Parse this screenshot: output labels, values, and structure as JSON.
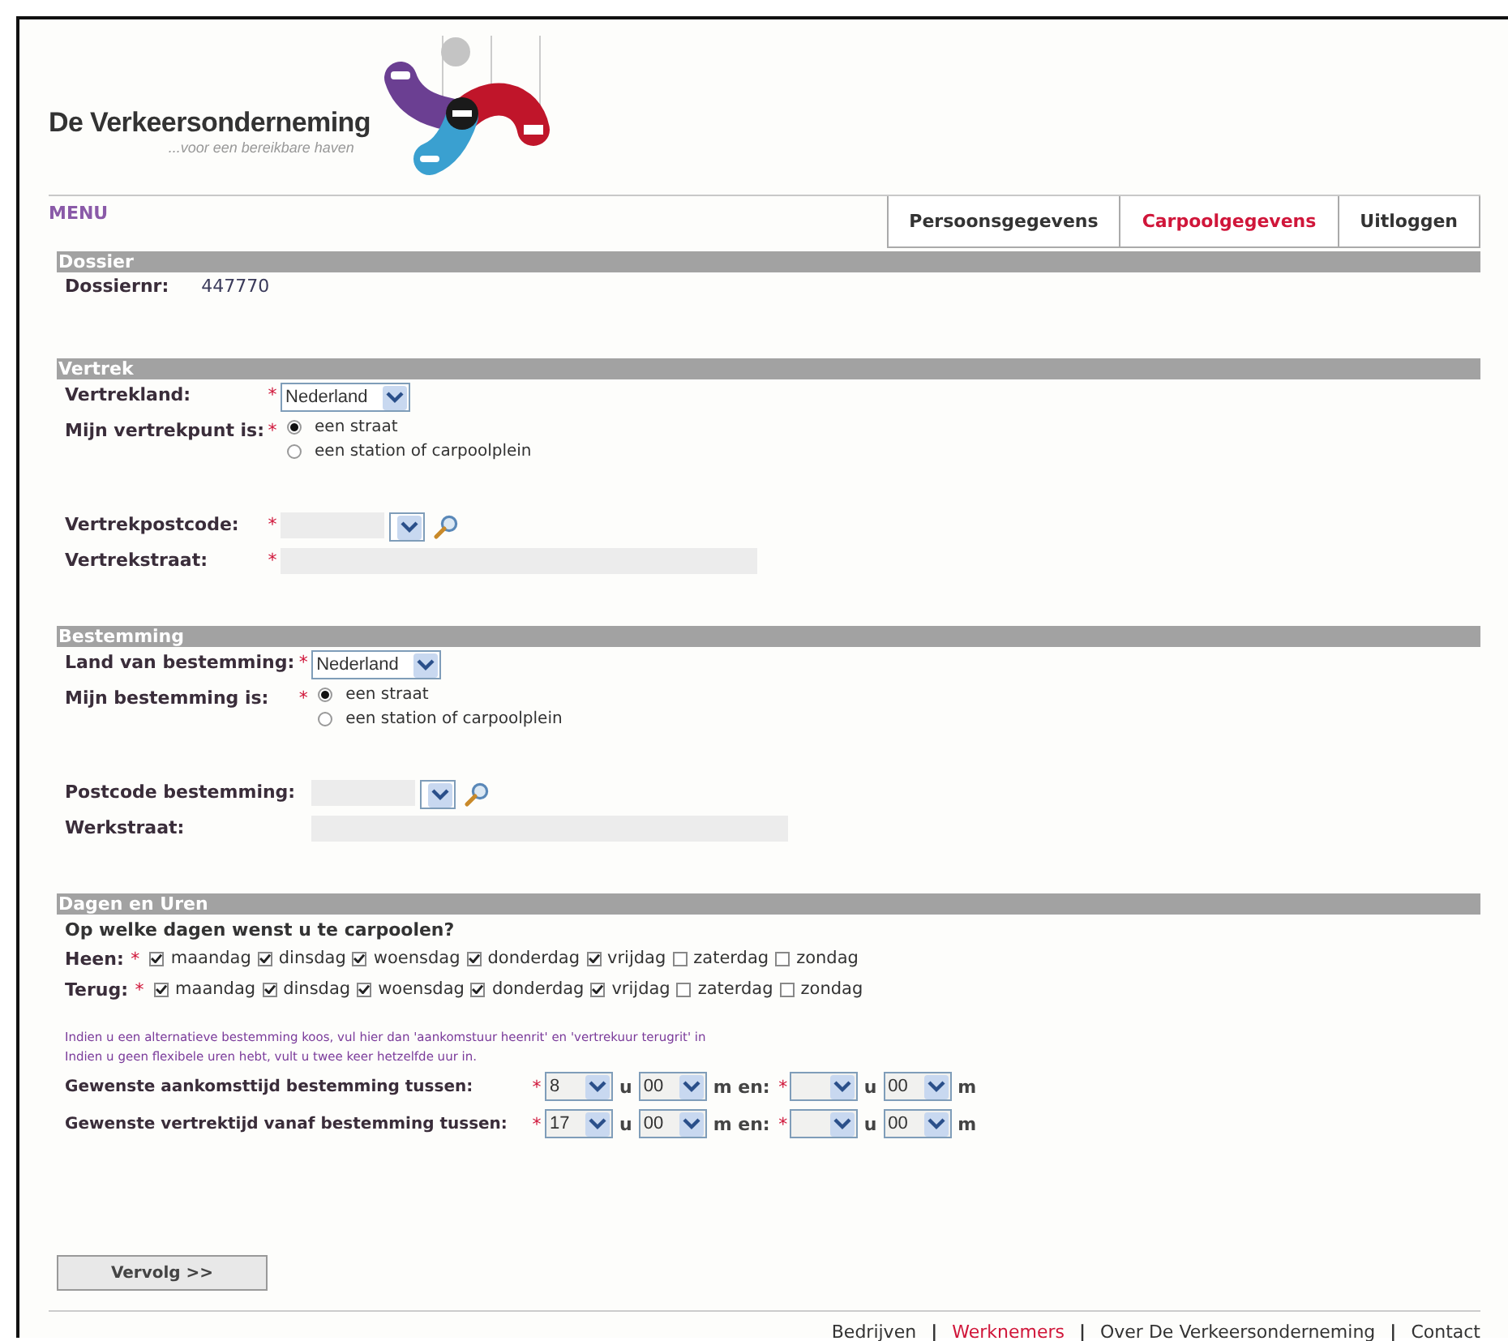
{
  "logo": {
    "title": "De Verkeersonderneming",
    "tagline": "...voor een bereikbare haven"
  },
  "menu_label": "MENU",
  "tabs": [
    {
      "label": "Persoonsgegevens",
      "selected": false
    },
    {
      "label": "Carpoolgegevens",
      "selected": true
    },
    {
      "label": "Uitloggen",
      "selected": false
    }
  ],
  "sections": [
    {
      "title": "Dossier",
      "kind": "fields",
      "fields": [
        {
          "kind": "text",
          "label": "Dossiernr:",
          "value": "447770"
        }
      ]
    },
    {
      "title": "Vertrek",
      "kind": "fields",
      "fields": [
        {
          "kind": "select",
          "label": "Vertrekland:",
          "required_mark": "*",
          "value": "Nederland"
        },
        {
          "kind": "radio",
          "label": "Mijn vertrekpunt is:",
          "required_mark": "*",
          "options": [
            {
              "label": "een straat",
              "selected": true
            },
            {
              "label": "een station of carpoolplein",
              "selected": false
            }
          ]
        },
        {
          "kind": "postcode",
          "label": "Vertrekpostcode:",
          "required_mark": "*"
        },
        {
          "kind": "textfield",
          "label": "Vertrekstraat:",
          "required_mark": "*"
        }
      ]
    },
    {
      "title": "Bestemming",
      "kind": "fields",
      "fields": [
        {
          "kind": "select",
          "label": "Land van bestemming:",
          "required_mark": "*",
          "value": "Nederland"
        },
        {
          "kind": "radio",
          "label": "Mijn bestemming is:",
          "required_mark": "*",
          "options": [
            {
              "label": "een straat",
              "selected": true
            },
            {
              "label": "een station of carpoolplein",
              "selected": false
            }
          ]
        },
        {
          "kind": "postcode",
          "label": "Postcode bestemming:"
        },
        {
          "kind": "textfield",
          "label": "Werkstraat:"
        }
      ]
    },
    {
      "title": "Dagen en Uren",
      "kind": "days",
      "question": "Op welke dagen wenst u te carpoolen?",
      "day_rows": [
        {
          "label": "Heen:",
          "required_mark": "*",
          "days": [
            {
              "label": "maandag",
              "checked": true
            },
            {
              "label": "dinsdag",
              "checked": true
            },
            {
              "label": "woensdag",
              "checked": true
            },
            {
              "label": "donderdag",
              "checked": true
            },
            {
              "label": "vrijdag",
              "checked": true
            },
            {
              "label": "zaterdag",
              "checked": false
            },
            {
              "label": "zondag",
              "checked": false
            }
          ]
        },
        {
          "label": "Terug:",
          "required_mark": "*",
          "days": [
            {
              "label": "maandag",
              "checked": true
            },
            {
              "label": "dinsdag",
              "checked": true
            },
            {
              "label": "woensdag",
              "checked": true
            },
            {
              "label": "donderdag",
              "checked": true
            },
            {
              "label": "vrijdag",
              "checked": true
            },
            {
              "label": "zaterdag",
              "checked": false
            },
            {
              "label": "zondag",
              "checked": false
            }
          ]
        }
      ],
      "notes": [
        "Indien u een alternatieve bestemming koos, vul hier dan 'aankomstuur heenrit' en 'vertrekuur terugrit' in",
        "Indien u geen flexibele uren hebt, vult u twee keer hetzelfde uur in."
      ],
      "time_rows": [
        {
          "label": "Gewenste aankomsttijd bestemming tussen:",
          "required_mark": "*",
          "parts": [
            {
              "kind": "select",
              "value": "8"
            },
            {
              "kind": "unit",
              "text": "u"
            },
            {
              "kind": "select",
              "value": "00"
            },
            {
              "kind": "unit",
              "text": "m en:"
            },
            {
              "kind": "mark",
              "text": "*"
            },
            {
              "kind": "select"
            },
            {
              "kind": "unit",
              "text": "u"
            },
            {
              "kind": "select",
              "value": "00"
            },
            {
              "kind": "unit",
              "text": "m"
            }
          ]
        },
        {
          "label": "Gewenste vertrektijd vanaf bestemming tussen:",
          "required_mark": "*",
          "parts": [
            {
              "kind": "select",
              "value": "17"
            },
            {
              "kind": "unit",
              "text": "u"
            },
            {
              "kind": "select",
              "value": "00"
            },
            {
              "kind": "unit",
              "text": "m en:"
            },
            {
              "kind": "mark",
              "text": "*"
            },
            {
              "kind": "select"
            },
            {
              "kind": "unit",
              "text": "u"
            },
            {
              "kind": "select",
              "value": "00"
            },
            {
              "kind": "unit",
              "text": "m"
            }
          ]
        }
      ]
    }
  ],
  "submit": "Vervolg >>",
  "footer": {
    "separator": "|",
    "links": [
      {
        "label": "Bedrijven",
        "selected": false
      },
      {
        "label": "Werknemers",
        "selected": true
      },
      {
        "label": "Over De Verkeersonderneming",
        "selected": false
      },
      {
        "label": "Contact",
        "selected": false
      }
    ]
  }
}
